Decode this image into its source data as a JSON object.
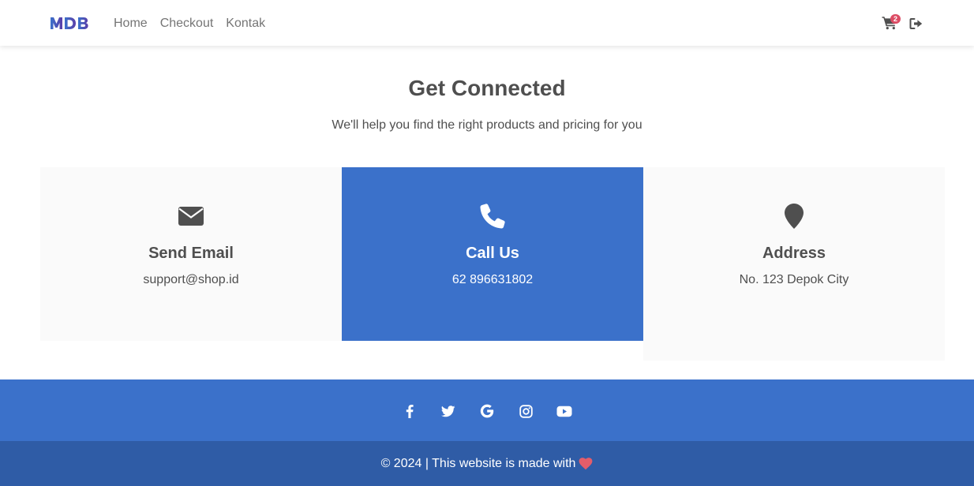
{
  "navbar": {
    "brand": "MDB",
    "links": [
      "Home",
      "Checkout",
      "Kontak"
    ],
    "cart_count": "2",
    "cart_icon": "cart-icon",
    "logout_icon": "logout-icon"
  },
  "hero": {
    "title": "Get Connected",
    "subtitle": "We'll help you find the right products and pricing for you"
  },
  "contacts": [
    {
      "icon": "envelope-icon",
      "title": "Send Email",
      "text": "support@shop.id"
    },
    {
      "icon": "phone-icon",
      "title": "Call Us",
      "text": "62 896631802"
    },
    {
      "icon": "map-marker-icon",
      "title": "Address",
      "text": "No. 123 Depok City"
    }
  ],
  "footer": {
    "social_icons": [
      "facebook-icon",
      "twitter-icon",
      "google-icon",
      "instagram-icon",
      "youtube-icon"
    ],
    "copyright": "© 2024 | This website is made with"
  },
  "colors": {
    "primary": "#3b71ca",
    "footer_dark": "#2f5ca6",
    "badge": "#dc4c64",
    "card_bg": "#fafafa",
    "text": "#4f4f4f"
  }
}
